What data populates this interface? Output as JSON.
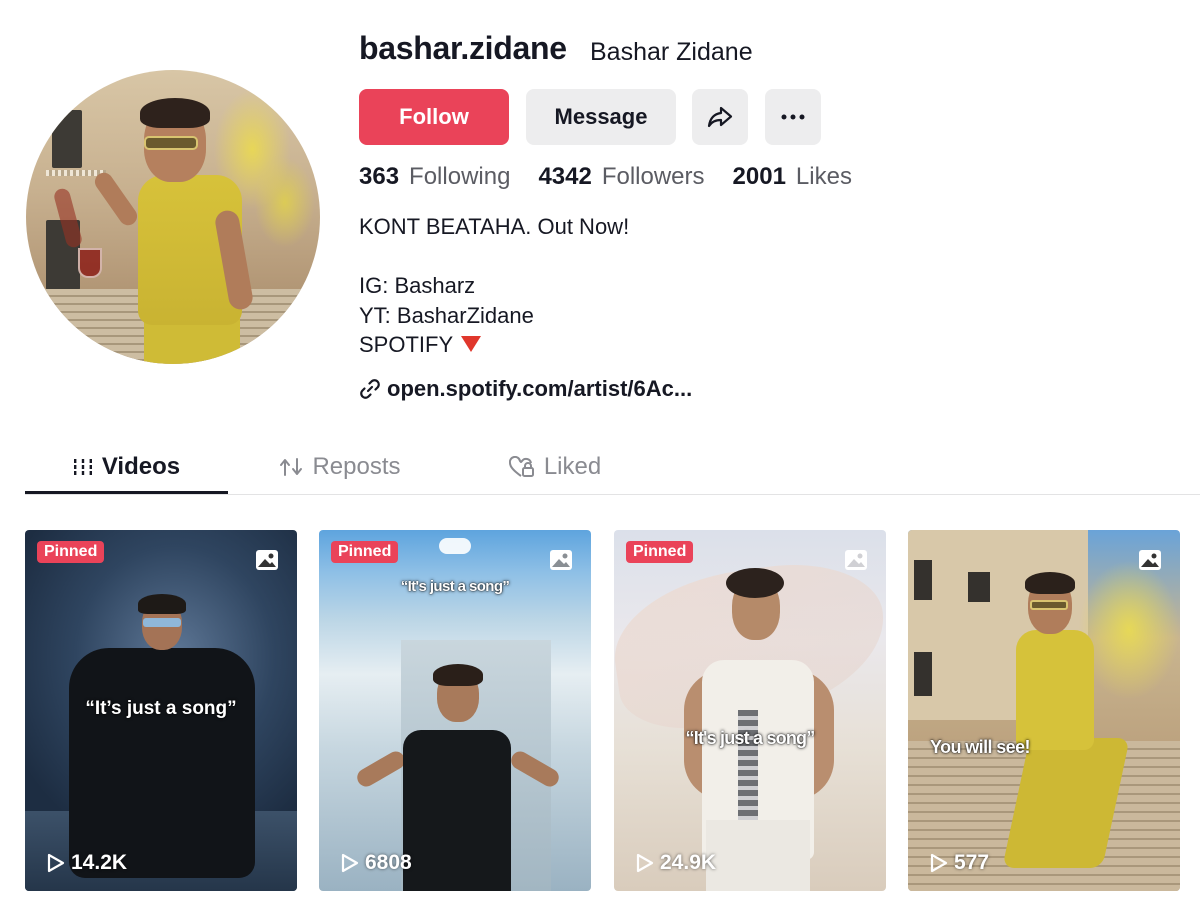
{
  "profile": {
    "username": "bashar.zidane",
    "display_name": "Bashar Zidane",
    "avatar_icon": "profile-photo"
  },
  "actions": {
    "follow_label": "Follow",
    "message_label": "Message",
    "share_icon": "share-arrow-icon",
    "more_icon": "more-dots-icon"
  },
  "stats": {
    "following_count": "363",
    "following_label": "Following",
    "followers_count": "4342",
    "followers_label": "Followers",
    "likes_count": "2001",
    "likes_label": "Likes"
  },
  "bio": {
    "line1": "KONT BEATAHA. Out Now!",
    "line2": "",
    "line3": "IG: Basharz",
    "line4": "YT: BasharZidane",
    "line5": "SPOTIFY"
  },
  "link": {
    "text": "open.spotify.com/artist/6Ac..."
  },
  "tabs": [
    {
      "label": "Videos",
      "icon": "grid-lines-icon",
      "active": true
    },
    {
      "label": "Reposts",
      "icon": "repost-icon",
      "active": false
    },
    {
      "label": "Liked",
      "icon": "heart-lock-icon",
      "active": false
    }
  ],
  "videos": [
    {
      "pinned": "Pinned",
      "caption": "“It’s just a song”",
      "views": "14.2K",
      "type_icon": "photo-icon"
    },
    {
      "pinned": "Pinned",
      "caption": "“It's just a song”",
      "views": "6808",
      "type_icon": "photo-icon"
    },
    {
      "pinned": "Pinned",
      "caption": "“It's just a song”",
      "views": "24.9K",
      "type_icon": "photo-icon"
    },
    {
      "pinned": "",
      "caption": "You will see!",
      "views": "577",
      "type_icon": "photo-icon"
    }
  ],
  "colors": {
    "accent": "#ea4359",
    "text": "#161823",
    "muted": "#8a8b91",
    "button_bg": "#ededee"
  }
}
